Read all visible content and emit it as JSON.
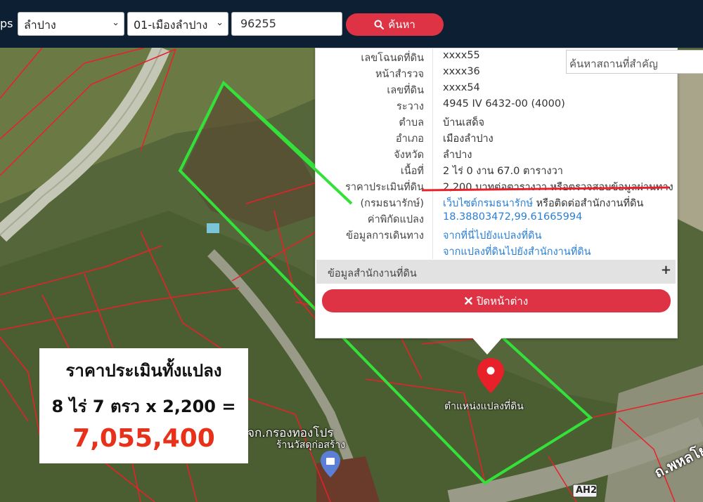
{
  "toolbar": {
    "prefix_text": "ps",
    "province_value": "ลำปาง",
    "district_value": "01-เมืองลำปาง",
    "parcel_number": "96255",
    "search_label": "ค้นหา"
  },
  "place_search": {
    "placeholder": "ค้นหาสถานที่สำคัญ"
  },
  "parcel_info": {
    "rows": [
      {
        "label": "เลขโฉนดที่ดิน",
        "value": "xxxx55"
      },
      {
        "label": "หน้าสำรวจ",
        "value": "xxxx36"
      },
      {
        "label": "เลขที่ดิน",
        "value": "xxxx54"
      },
      {
        "label": "ระวาง",
        "value": "4945 IV 6432-00 (4000)"
      },
      {
        "label": "ตำบล",
        "value": "บ้านเสด็จ"
      },
      {
        "label": "อำเภอ",
        "value": "เมืองลำปาง"
      },
      {
        "label": "จังหวัด",
        "value": "ลำปาง"
      },
      {
        "label": "เนื้อที่",
        "value": "2 ไร่ 0 งาน 67.0 ตารางวา"
      },
      {
        "label": "ราคาประเมินที่ดิน",
        "value": "2,200 บาทต่อตารางวา หรือตรวจสอบข้อมูลผ่านทาง"
      },
      {
        "label": "(กรมธนารักษ์)",
        "value": "เว็บไซต์กรมธนารักษ์",
        "value_suffix": "หรือติดต่อสำนักงานที่ดิน"
      },
      {
        "label": "ค่าพิกัดแปลง",
        "value": "18.38803472,99.61665994"
      },
      {
        "label": "ข้อมูลการเดินทาง",
        "value": "จากที่นี่ไปยังแปลงที่ดิน"
      },
      {
        "label": "",
        "value": "จากแปลงที่ดินไปยังสำนักงานที่ดิน"
      }
    ],
    "office_section_label": "ข้อมูลสำนักงานที่ดิน",
    "close_label": "ปิดหน้าต่าง"
  },
  "map_labels": {
    "parcel_marker_label": "ตำแหน่งแปลงที่ดิน",
    "shop_label_1": "จก.กรองทองโปร",
    "shop_label_2": "ร้านวัสดุก่อสร้าง",
    "road_sign": "AH2",
    "road_name": "ถ.พหลโยธิน"
  },
  "annotation": {
    "line1": "ราคาประเมินทั้งแปลง",
    "line2": "8 ไร่ 7 ตรว x 2,200 =",
    "total": "7,055,400"
  },
  "colors": {
    "topbar": "#0d1f33",
    "accent_red": "#dd3345",
    "parcel_outline": "#34e03a",
    "boundary_lines": "#e8202a",
    "total_text": "#e8311a"
  }
}
